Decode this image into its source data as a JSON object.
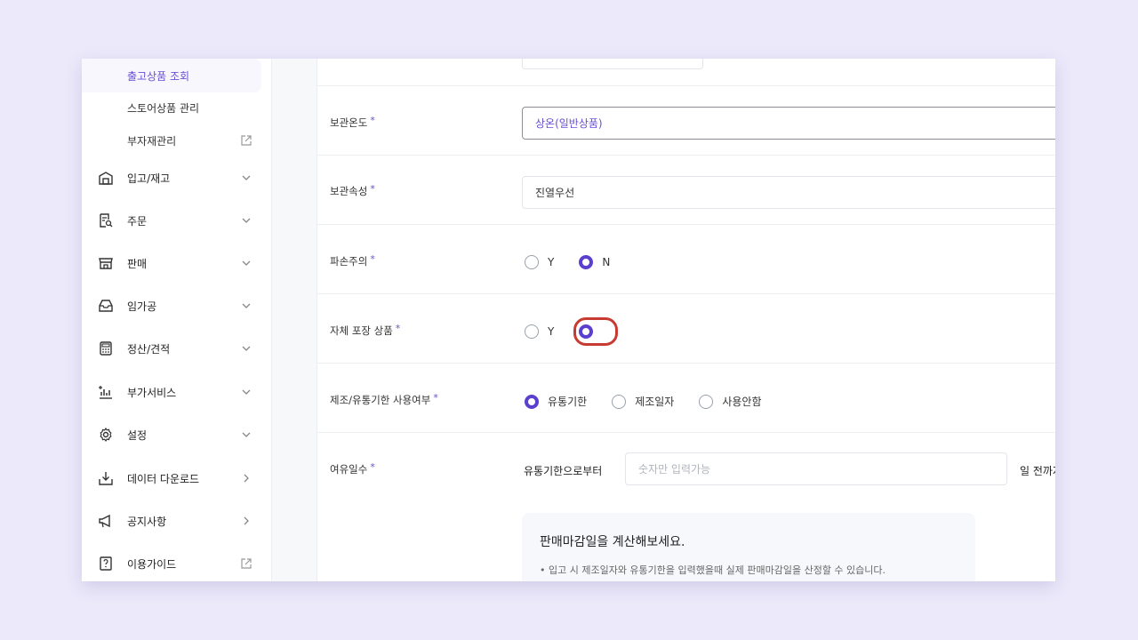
{
  "sidebar": {
    "sub_items": [
      {
        "label": "출고상품 조회",
        "active": true
      },
      {
        "label": "스토어상품 관리"
      },
      {
        "label": "부자재관리",
        "external": true
      }
    ],
    "nav_items": [
      {
        "label": "입고/재고",
        "icon": "warehouse-icon",
        "arrow": "down"
      },
      {
        "label": "주문",
        "icon": "order-search-icon",
        "arrow": "down"
      },
      {
        "label": "판매",
        "icon": "store-icon",
        "arrow": "down"
      },
      {
        "label": "임가공",
        "icon": "inbox-icon",
        "arrow": "down"
      },
      {
        "label": "정산/견적",
        "icon": "calculator-icon",
        "arrow": "down"
      },
      {
        "label": "부가서비스",
        "icon": "chart-plus-icon",
        "arrow": "down"
      },
      {
        "label": "설정",
        "icon": "gear-icon",
        "arrow": "down"
      },
      {
        "label": "데이터 다운로드",
        "icon": "download-icon",
        "arrow": "right"
      },
      {
        "label": "공지사항",
        "icon": "megaphone-icon",
        "arrow": "right"
      },
      {
        "label": "이용가이드",
        "icon": "guide-icon",
        "arrow": "external"
      }
    ]
  },
  "form": {
    "storage_temp": {
      "label": "보관온도",
      "value": "상온(일반상품)"
    },
    "storage_attr": {
      "label": "보관속성",
      "value": "진열우선"
    },
    "fragile": {
      "label": "파손주의",
      "options": [
        "Y",
        "N"
      ],
      "selected": "N"
    },
    "self_pack": {
      "label": "자체 포장 상품",
      "options": [
        "Y",
        "N"
      ],
      "selected": "N"
    },
    "expiry_usage": {
      "label": "제조/유통기한 사용여부",
      "options": [
        "유통기한",
        "제조일자",
        "사용안함"
      ],
      "selected": "유통기한"
    },
    "spare_days": {
      "label": "여유일수",
      "prefix": "유통기한으로부터",
      "placeholder": "숫자만 입력가능",
      "suffix": "일 전까지"
    },
    "required_mark": "*"
  },
  "calc_box": {
    "title": "판매마감일을 계산해보세요.",
    "note": "•  입고 시 제조일자와 유통기한을 입력했을때 실제 판매마감일을 산정할 수 있습니다."
  },
  "colors": {
    "accent": "#5b3fcf",
    "highlight": "#c73b32"
  }
}
